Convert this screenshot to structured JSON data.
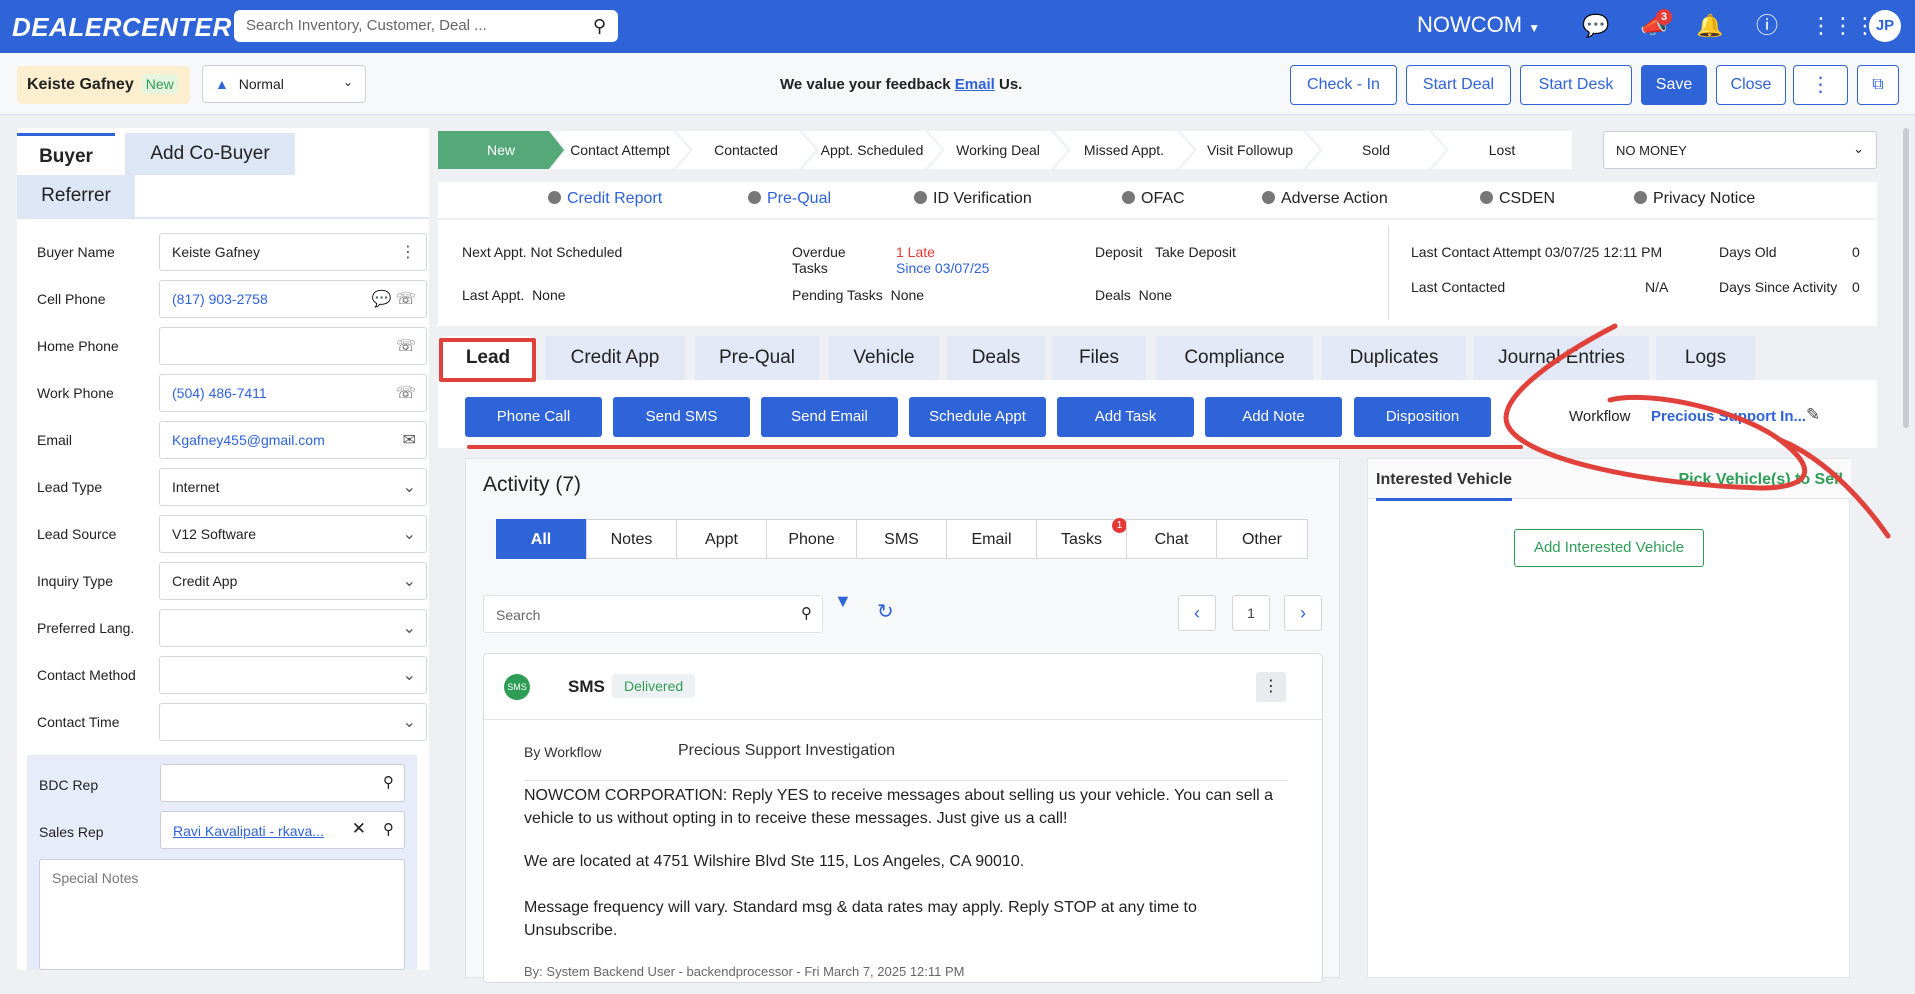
{
  "header": {
    "logo": "DEALERCENTER",
    "search_placeholder": "Search Inventory, Customer, Deal ...",
    "company": "NOWCOM",
    "notification_count": "3",
    "avatar": "JP"
  },
  "subheader": {
    "customer_name": "Keiste Gafney",
    "customer_status": "New",
    "priority": "Normal",
    "feedback_prefix": "We value your feedback",
    "feedback_link": "Email",
    "feedback_suffix": "Us.",
    "buttons": [
      "Check - In",
      "Start Deal",
      "Start Desk",
      "Save",
      "Close"
    ]
  },
  "left": {
    "tabs": [
      "Buyer",
      "Add Co-Buyer",
      "Referrer"
    ],
    "fields": [
      {
        "label": "Buyer Name",
        "value": "Keiste Gafney"
      },
      {
        "label": "Cell Phone",
        "value": "(817) 903-2758"
      },
      {
        "label": "Home Phone",
        "value": ""
      },
      {
        "label": "Work Phone",
        "value": "(504) 486-7411"
      },
      {
        "label": "Email",
        "value": "Kgafney455@gmail.com"
      },
      {
        "label": "Lead Type",
        "value": "Internet"
      },
      {
        "label": "Lead Source",
        "value": "V12 Software"
      },
      {
        "label": "Inquiry Type",
        "value": "Credit App"
      },
      {
        "label": "Preferred Lang.",
        "value": ""
      },
      {
        "label": "Contact Method",
        "value": ""
      },
      {
        "label": "Contact Time",
        "value": ""
      }
    ],
    "bdc_label": "BDC Rep",
    "sales_label": "Sales Rep",
    "sales_value": "Ravi Kavalipati - rkava...",
    "notes_placeholder": "Special Notes"
  },
  "pipeline": {
    "stages": [
      "New",
      "Contact Attempt",
      "Contacted",
      "Appt. Scheduled",
      "Working Deal",
      "Missed Appt.",
      "Visit Followup",
      "Sold",
      "Lost"
    ],
    "status_select": "NO MONEY"
  },
  "docs": [
    "Credit Report",
    "Pre-Qual",
    "ID Verification",
    "OFAC",
    "Adverse Action",
    "CSDEN",
    "Privacy Notice"
  ],
  "info": {
    "next_appt": "Next Appt. Not Scheduled",
    "last_appt_label": "Last Appt.",
    "last_appt_value": "None",
    "overdue_label": "Overdue Tasks",
    "overdue_value": "1 Late",
    "overdue_since": "Since 03/07/25",
    "pending_label": "Pending Tasks",
    "pending_value": "None",
    "deposit_label": "Deposit",
    "deposit_value": "Take Deposit",
    "deals_label": "Deals",
    "deals_value": "None",
    "last_contact_attempt": "Last Contact Attempt 03/07/25 12:11 PM",
    "last_contacted_label": "Last Contacted",
    "last_contacted_value": "N/A",
    "days_old_label": "Days Old",
    "days_old_value": "0",
    "days_since_label": "Days Since Activity",
    "days_since_value": "0"
  },
  "tabs": [
    "Lead",
    "Credit App",
    "Pre-Qual",
    "Vehicle",
    "Deals",
    "Files",
    "Compliance",
    "Duplicates",
    "Journal Entries",
    "Logs"
  ],
  "actions": [
    "Phone Call",
    "Send SMS",
    "Send Email",
    "Schedule Appt",
    "Add Task",
    "Add Note",
    "Disposition"
  ],
  "workflow": {
    "label": "Workflow",
    "value": "Precious Support In..."
  },
  "activity": {
    "title": "Activity (7)",
    "filters": [
      "All",
      "Notes",
      "Appt",
      "Phone",
      "SMS",
      "Email",
      "Tasks",
      "Chat",
      "Other"
    ],
    "tasks_badge": "1",
    "search_placeholder": "Search",
    "page": "1",
    "item": {
      "type": "SMS",
      "status": "Delivered",
      "by_label": "By Workflow",
      "by_value": "Precious Support Investigation",
      "para1": "NOWCOM CORPORATION: Reply YES to receive messages about selling us your vehicle. You can sell a vehicle to us without opting in to receive these messages. Just give us a call!",
      "para2": "We are located at 4751 Wilshire Blvd Ste 115, Los Angeles, CA 90010.",
      "para3": "Message frequency will vary. Standard msg & data rates may apply. Reply STOP at any time to Unsubscribe.",
      "footer": "By: System Backend User - backendprocessor - Fri March 7, 2025 12:11 PM"
    }
  },
  "interested": {
    "tab1": "Interested Vehicle",
    "tab2": "Pick Vehicle(s) to Sell",
    "button": "Add Interested Vehicle"
  },
  "colors": {
    "brand": "#2f63d8",
    "stage_active": "#55a878",
    "annotation": "#e0413a"
  }
}
